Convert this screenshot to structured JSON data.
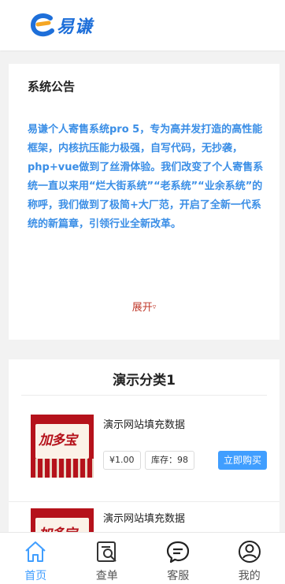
{
  "header": {
    "logo_text": "易谦"
  },
  "notice": {
    "title": "系统公告",
    "body": "易谦个人寄售系统pro 5，专为高并发打造的高性能框架，内核抗压能力极强，自写代码，无抄袭，php+vue做到了丝滑体验。我们改变了个人寄售系统一直以来用“烂大街系统”“老系统”“业余系统”的称呼，我们做到了极简+大厂范，开启了全新一代系统的新篇章，引领行业全新改革。",
    "expand_label": "展开",
    "expand_icon": "caret-down-icon"
  },
  "category": {
    "title": "演示分类1",
    "items": [
      {
        "brand_text": "加多宝",
        "name": "演示网站填充数据",
        "price": "¥1.00",
        "stock": "库存：98",
        "buy_label": "立即购买"
      },
      {
        "brand_text": "加多宝",
        "name": "演示网站填充数据"
      }
    ]
  },
  "tabbar": {
    "items": [
      {
        "label": "首页",
        "icon": "home-icon",
        "active": true
      },
      {
        "label": "查单",
        "icon": "order-search-icon",
        "active": false
      },
      {
        "label": "客服",
        "icon": "chat-icon",
        "active": false
      },
      {
        "label": "我的",
        "icon": "user-icon",
        "active": false
      }
    ]
  },
  "colors": {
    "accent": "#409eff",
    "notice_text": "#3a8ee6",
    "expand": "#c0392b",
    "brand_red": "#b5121b"
  }
}
